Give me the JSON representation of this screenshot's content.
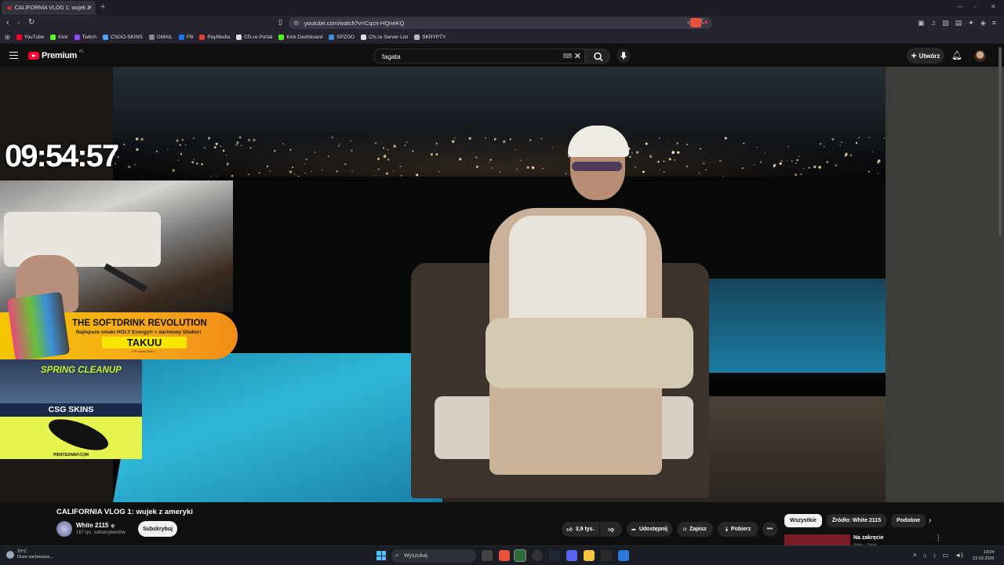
{
  "browser": {
    "tab_title": "CALIFORNIA VLOG 1: wujek z",
    "url": "youtube.com/watch?v=Cqcn-HQneKQ",
    "bookmarks": [
      {
        "label": "YouTube",
        "color": "#ff0033"
      },
      {
        "label": "Kick",
        "color": "#53fc18"
      },
      {
        "label": "Twitch",
        "color": "#9146ff"
      },
      {
        "label": "CSGO-SKINS",
        "color": "#4aa3ff"
      },
      {
        "label": "GMAIL",
        "color": "#888888"
      },
      {
        "label": "FB",
        "color": "#1877f2"
      },
      {
        "label": "PayMedia",
        "color": "#e53b3b"
      },
      {
        "label": "Cfx.re Portal",
        "color": "#dddddd"
      },
      {
        "label": "Kick Dashboard",
        "color": "#53fc18"
      },
      {
        "label": "SPZOO",
        "color": "#3b8fd9"
      },
      {
        "label": "Cfx.re Server List",
        "color": "#dddddd"
      },
      {
        "label": "SKRYPTY",
        "color": "#bbbbbb"
      }
    ]
  },
  "youtube": {
    "logo_text": "Premium",
    "region": "PL",
    "search_value": "fagata",
    "create_label": "Utwórz"
  },
  "overlay": {
    "timer": "09:54:57",
    "drink_title": "THE SOFTDRINK REVOLUTION",
    "drink_sub": "Najlepsze smaki HOLY Energy® + darmowy Shaker!",
    "drink_code": "TAKUU",
    "drink_small": "10% rabatu kodem",
    "spring": "SPRING CLEANUP",
    "csg": "CSG SKINS",
    "pirate": "PIRATESWAP.COM"
  },
  "video": {
    "title": "CALIFORNIA VLOG 1: wujek z ameryki",
    "channel": "White 2115",
    "subscribers": "167 tys. subskrybentów",
    "subscribe_label": "Subskrybuj",
    "likes": "3,9 tys.",
    "share_label": "Udostępnij",
    "save_label": "Zapisz",
    "download_label": "Pobierz"
  },
  "related": {
    "chips": [
      "Wszystkie",
      "Źródło: White 2115",
      "Podobne"
    ],
    "first_title": "Na zakręcie",
    "first_sub": "Pinka - Zonia"
  },
  "taskbar": {
    "temp": "15°C",
    "weather_desc": "Duże zachmurze...",
    "search_placeholder": "Wyszukaj",
    "time": "13:04",
    "date": "23.03.2026"
  }
}
